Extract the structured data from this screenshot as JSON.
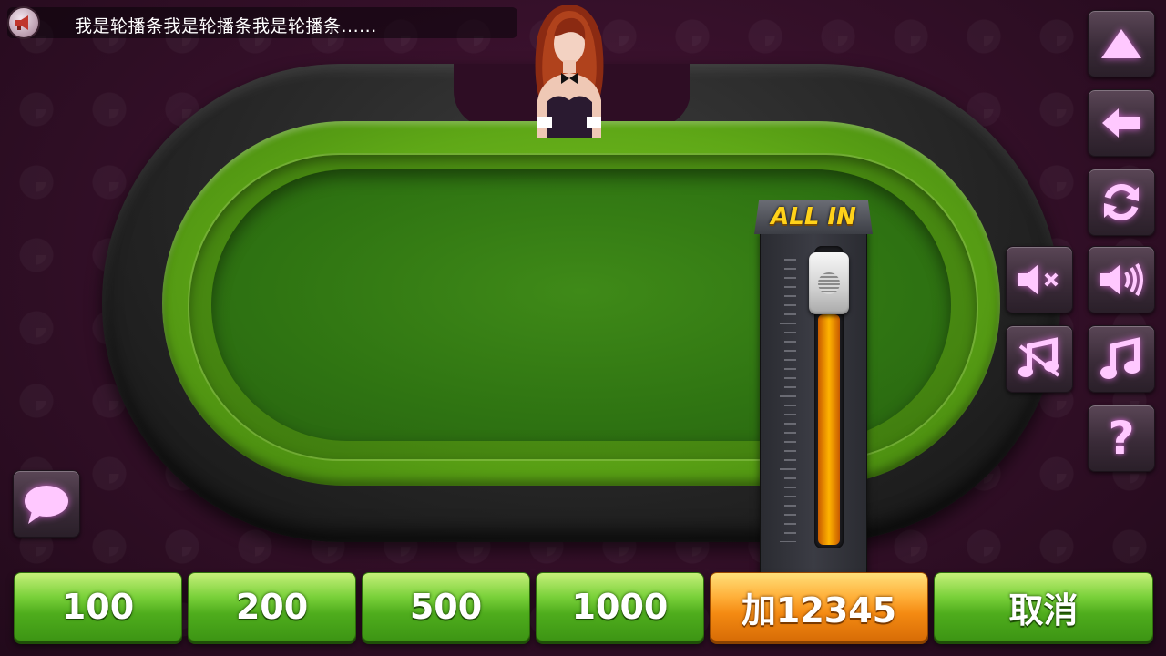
{
  "broadcast": {
    "icon": "megaphone-icon",
    "text": "我是轮播条我是轮播条我是轮播条......"
  },
  "slider": {
    "allin_label": "ALL IN",
    "fill_fraction": 0.78
  },
  "side_buttons": [
    {
      "name": "up-button",
      "icon": "up-arrow-icon"
    },
    {
      "name": "back-button",
      "icon": "left-arrow-icon"
    },
    {
      "name": "refresh-button",
      "icon": "refresh-icon"
    },
    {
      "name": "sound-on-button",
      "icon": "speaker-on-icon"
    },
    {
      "name": "mute-button",
      "icon": "speaker-mute-icon"
    },
    {
      "name": "music-button",
      "icon": "music-note-icon"
    },
    {
      "name": "music-off-button",
      "icon": "music-off-icon"
    },
    {
      "name": "help-button",
      "icon": "question-icon",
      "label": "?"
    }
  ],
  "chat": {
    "icon": "chat-bubble-icon"
  },
  "bet_buttons": [
    {
      "label": "100"
    },
    {
      "label": "200"
    },
    {
      "label": "500"
    },
    {
      "label": "1000"
    },
    {
      "label": "加12345"
    },
    {
      "label": "取消"
    }
  ],
  "colors": {
    "accent_icon": "#ff88ff",
    "green_button": "#4fad1d",
    "orange_button": "#f48a12",
    "allin_text": "#ffd21a"
  }
}
